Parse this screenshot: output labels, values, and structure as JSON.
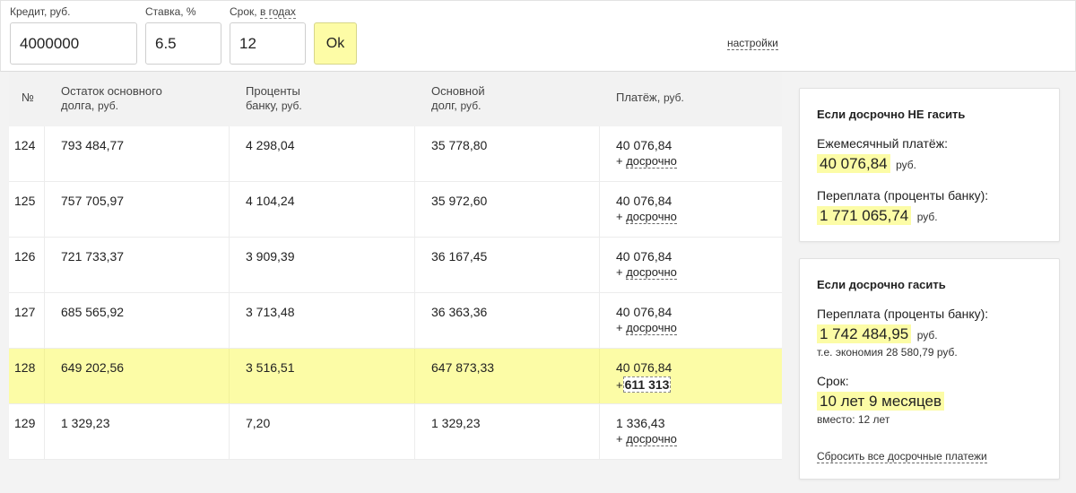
{
  "top": {
    "credit": {
      "label": "Кредит, руб.",
      "value": "4000000"
    },
    "rate": {
      "label": "Ставка, %",
      "value": "6.5"
    },
    "term": {
      "label_prefix": "Срок,",
      "label_link": "в годах",
      "value": "12"
    },
    "ok_label": "Ok",
    "settings_label": "настройки"
  },
  "table": {
    "headers": {
      "n": "№",
      "rest_line1": "Остаток основного",
      "rest_line2": "долга,",
      "rest_unit": "руб.",
      "int_line1": "Проценты",
      "int_line2": "банку,",
      "int_unit": "руб.",
      "main_line1": "Основной",
      "main_line2": "долг,",
      "main_unit": "руб.",
      "pay_line1": "Платёж,",
      "pay_unit": "руб."
    },
    "early_plus": "+",
    "early_link": "досрочно",
    "rows": [
      {
        "n": "124",
        "rest": "793 484,77",
        "interest": "4 298,04",
        "principal": "35 778,80",
        "payment": "40 076,84"
      },
      {
        "n": "125",
        "rest": "757 705,97",
        "interest": "4 104,24",
        "principal": "35 972,60",
        "payment": "40 076,84"
      },
      {
        "n": "126",
        "rest": "721 733,37",
        "interest": "3 909,39",
        "principal": "36 167,45",
        "payment": "40 076,84"
      },
      {
        "n": "127",
        "rest": "685 565,92",
        "interest": "3 713,48",
        "principal": "36 363,36",
        "payment": "40 076,84"
      },
      {
        "n": "128",
        "rest": "649 202,56",
        "interest": "3 516,51",
        "principal": "647 873,33",
        "payment": "40 076,84",
        "early_amount": "611 313"
      },
      {
        "n": "129",
        "rest": "1 329,23",
        "interest": "7,20",
        "principal": "1 329,23",
        "payment": "1 336,43"
      }
    ]
  },
  "card_no_early": {
    "title": "Если досрочно НЕ гасить",
    "monthly_label": "Ежемесячный платёж:",
    "monthly_value": "40 076,84",
    "overpay_label": "Переплата (проценты банку):",
    "overpay_value": "1 771 065,74",
    "currency": "руб."
  },
  "card_early": {
    "title": "Если досрочно гасить",
    "overpay_label": "Переплата (проценты банку):",
    "overpay_value": "1 742 484,95",
    "currency": "руб.",
    "savings_note": "т.е. экономия 28 580,79 руб.",
    "term_label": "Срок:",
    "term_value": "10 лет 9 месяцев",
    "instead_note": "вместо: 12 лет",
    "reset_label": "Сбросить все досрочные платежи"
  },
  "colors": {
    "highlight": "#fcfca6",
    "ok_button": "#fdfca6"
  }
}
